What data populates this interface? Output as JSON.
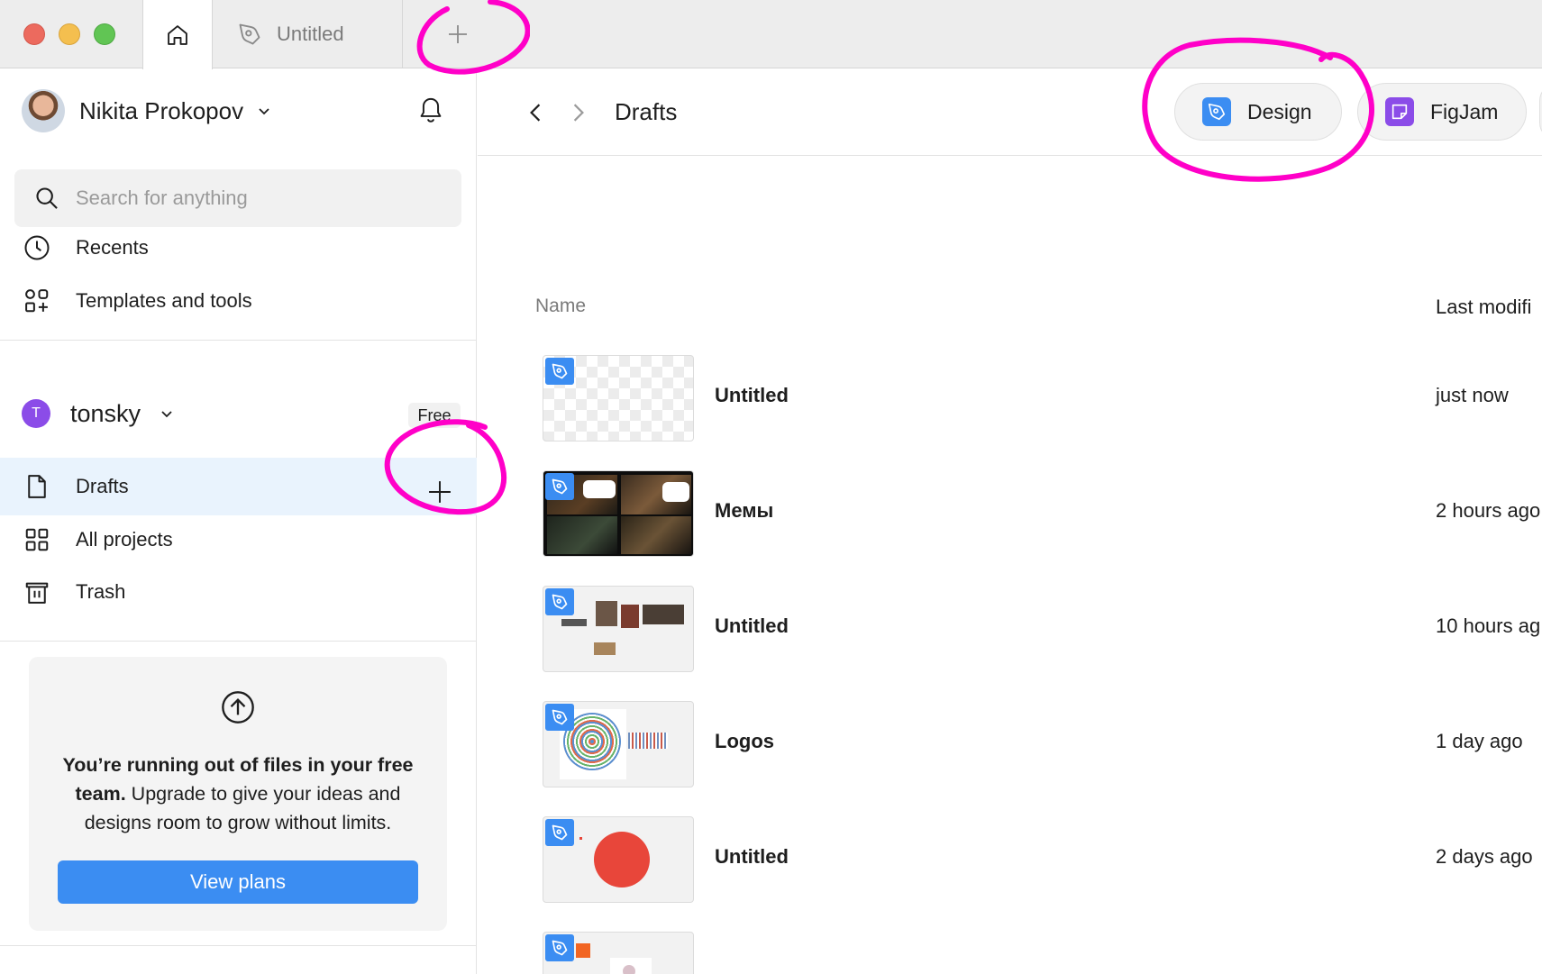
{
  "tabs": {
    "home_icon": "home-icon",
    "file_tab": "Untitled"
  },
  "user": {
    "name": "Nikita Prokopov"
  },
  "search": {
    "placeholder": "Search for anything"
  },
  "nav": {
    "recents": "Recents",
    "templates": "Templates and tools"
  },
  "team": {
    "initial": "T",
    "name": "tonsky",
    "plan": "Free"
  },
  "team_nav": {
    "drafts": "Drafts",
    "all_projects": "All projects",
    "trash": "Trash"
  },
  "upsell": {
    "bold": "You’re running out of files in your free team.",
    "text": " Upgrade to give your ideas and designs room to grow without limits.",
    "button": "View plans"
  },
  "header": {
    "title": "Drafts",
    "design_button": "Design",
    "figjam_button": "FigJam"
  },
  "columns": {
    "name": "Name",
    "modified": "Last modifi"
  },
  "files": [
    {
      "name": "Untitled",
      "time": "just now"
    },
    {
      "name": "Мемы",
      "time": "2 hours ago"
    },
    {
      "name": "Untitled",
      "time": "10 hours ag"
    },
    {
      "name": "Logos",
      "time": "1 day ago"
    },
    {
      "name": "Untitled",
      "time": "2 days ago"
    }
  ],
  "colors": {
    "accent": "#3b8df2",
    "figjam": "#8b4ce8",
    "annotation": "#ff00c8",
    "active_row": "#e9f3fd"
  }
}
